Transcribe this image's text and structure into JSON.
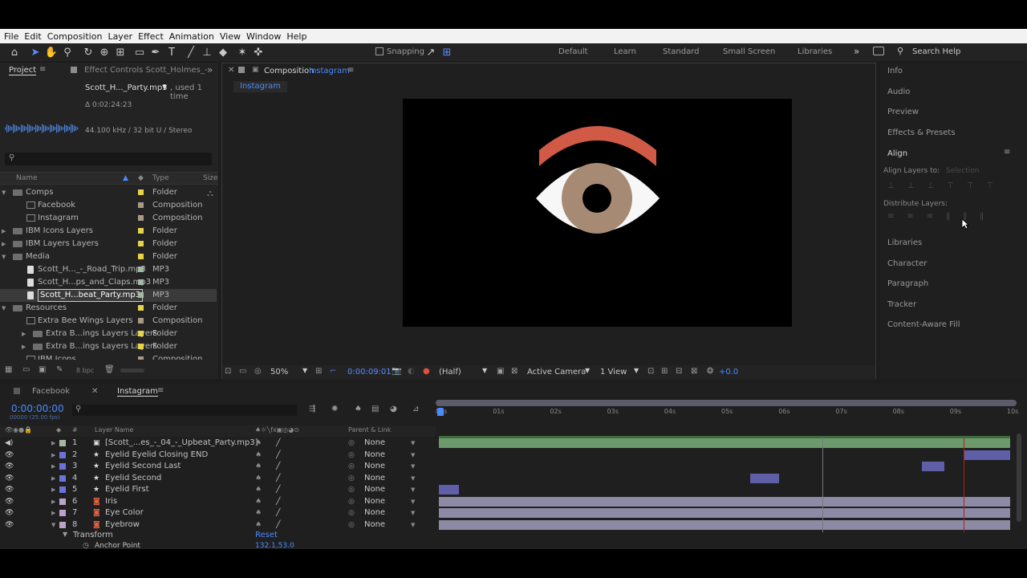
{
  "menu": [
    "File",
    "Edit",
    "Composition",
    "Layer",
    "Effect",
    "Animation",
    "View",
    "Window",
    "Help"
  ],
  "toolbar": {
    "snapping": "Snapping",
    "search_placeholder": "Search Help"
  },
  "workspaces": [
    "Default",
    "Learn",
    "Standard",
    "Small Screen",
    "Libraries"
  ],
  "project": {
    "tab": "Project",
    "effect_tab": "Effect Controls Scott_Holmes_-",
    "file_name": "Scott_H..._Party.mp3",
    "used": ", used 1 time",
    "duration": "Δ 0:02:24:23",
    "audio_info": "44.100 kHz / 32 bit U / Stereo",
    "search_placeholder": "",
    "cols": {
      "name": "Name",
      "type": "Type",
      "size": "Size"
    },
    "rows": [
      {
        "name": "Comps",
        "type": "Folder",
        "indent": 0,
        "kind": "folder",
        "open": true,
        "color": "#e8d24a"
      },
      {
        "name": "Facebook",
        "type": "Composition",
        "indent": 1,
        "kind": "comp",
        "color": "#a99a87"
      },
      {
        "name": "Instagram",
        "type": "Composition",
        "indent": 1,
        "kind": "comp",
        "color": "#a99a87"
      },
      {
        "name": "IBM Icons Layers",
        "type": "Folder",
        "indent": 0,
        "kind": "folder",
        "open": false,
        "color": "#e8d24a"
      },
      {
        "name": "IBM Layers Layers",
        "type": "Folder",
        "indent": 0,
        "kind": "folder",
        "open": false,
        "color": "#e8d24a"
      },
      {
        "name": "Media",
        "type": "Folder",
        "indent": 0,
        "kind": "folder",
        "open": true,
        "color": "#e8d24a"
      },
      {
        "name": "Scott_H..._-_Road_Trip.mp3",
        "type": "MP3",
        "indent": 1,
        "kind": "mp3",
        "color": "#a4b9a4"
      },
      {
        "name": "Scott_H...ps_and_Claps.mp3",
        "type": "MP3",
        "indent": 1,
        "kind": "mp3",
        "color": "#a4b9a4"
      },
      {
        "name": "Scott_H...beat_Party.mp3",
        "type": "MP3",
        "indent": 1,
        "kind": "mp3",
        "color": "#a4b9a4",
        "selected": true
      },
      {
        "name": "Resources",
        "type": "Folder",
        "indent": 0,
        "kind": "folder",
        "open": true,
        "color": "#e8d24a"
      },
      {
        "name": "Extra Bee Wings Layers",
        "type": "Composition",
        "indent": 1,
        "kind": "comp",
        "color": "#a99a87"
      },
      {
        "name": "Extra B...ings Layers Layers",
        "type": "Folder",
        "indent": 1,
        "kind": "folder",
        "open": false,
        "color": "#e8d24a"
      },
      {
        "name": "Extra B...ings Layers Layers",
        "type": "Folder",
        "indent": 1,
        "kind": "folder",
        "open": false,
        "color": "#e8d24a"
      },
      {
        "name": "IBM Icons",
        "type": "Composition",
        "indent": 1,
        "kind": "comp",
        "color": "#a99a87"
      }
    ],
    "bpc": "8 bpc"
  },
  "composition": {
    "tab_label": "Composition",
    "tab_name": "Instagram",
    "sub_tab": "Instagram",
    "zoom": "50%",
    "timecode": "0:00:09:01",
    "resolution": "(Half)",
    "camera": "Active Camera",
    "views": "1 View",
    "exposure": "+0.0"
  },
  "right_panels": [
    "Info",
    "Audio",
    "Preview",
    "Effects & Presets",
    "Align",
    "Libraries",
    "Character",
    "Paragraph",
    "Tracker",
    "Content-Aware Fill"
  ],
  "align": {
    "align_to_label": "Align Layers to:",
    "align_to_value": "Selection",
    "distribute_label": "Distribute Layers:"
  },
  "timeline": {
    "tabs": [
      "Facebook",
      "Instagram"
    ],
    "timecode": "0:00:00:00",
    "fps": "00000 (25.00 fps)",
    "col_layer_name": "Layer Name",
    "col_parent": "Parent & Link",
    "ruler": [
      "00s",
      "01s",
      "02s",
      "03s",
      "04s",
      "05s",
      "06s",
      "07s",
      "08s",
      "09s",
      "10s"
    ],
    "layers": [
      {
        "num": "1",
        "name": "[Scott_...es_-_04_-_Upbeat_Party.mp3]",
        "parent": "None",
        "color": "#a4b9a4",
        "kind": "audio"
      },
      {
        "num": "2",
        "name": "Eyelid Eyelid Closing END",
        "parent": "None",
        "color": "#6b72d9",
        "kind": "shape"
      },
      {
        "num": "3",
        "name": "Eyelid Second Last",
        "parent": "None",
        "color": "#6b72d9",
        "kind": "shape"
      },
      {
        "num": "4",
        "name": "Eyelid Second",
        "parent": "None",
        "color": "#6b72d9",
        "kind": "shape"
      },
      {
        "num": "5",
        "name": "Eyelid First",
        "parent": "None",
        "color": "#6b72d9",
        "kind": "shape"
      },
      {
        "num": "6",
        "name": "Iris",
        "parent": "None",
        "color": "#b9a4c9",
        "kind": "ai"
      },
      {
        "num": "7",
        "name": "Eye Color",
        "parent": "None",
        "color": "#b9a4c9",
        "kind": "ai"
      },
      {
        "num": "8",
        "name": "Eyebrow",
        "parent": "None",
        "color": "#b9a4c9",
        "kind": "ai"
      }
    ],
    "transform": "Transform",
    "reset": "Reset",
    "anchor_label": "Anchor Point",
    "anchor_value": "132.1,53.0"
  }
}
